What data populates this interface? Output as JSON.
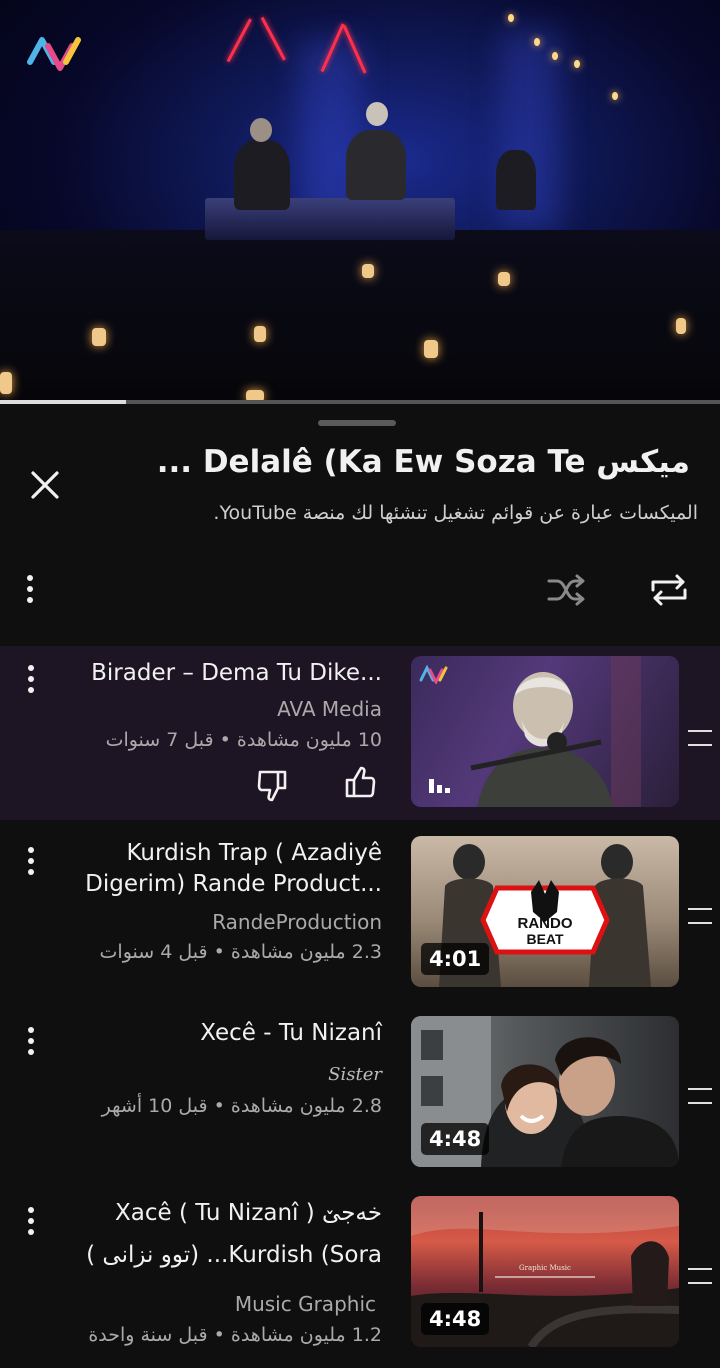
{
  "player": {
    "channel_logo": "ava-logo-icon",
    "progress_fraction": 0.175
  },
  "panel": {
    "title": "ميكس Delalê (Ka Ew Soza Te ...",
    "subtitle": "الميكسات عبارة عن قوائم تشغيل تنشئها لك منصة YouTube.",
    "icons": {
      "close": "close-icon",
      "more": "more-vert-icon",
      "shuffle": "shuffle-icon",
      "repeat": "repeat-icon"
    }
  },
  "items": [
    {
      "title": "Birader – Dema Tu Dike...",
      "channel": "AVA Media",
      "meta": "10 مليون مشاهدة • قبل 7 سنوات",
      "duration": "",
      "active": true
    },
    {
      "title": "Kurdish Trap ( Azadiyê Digerim) Rande Product...",
      "channel": "RandeProduction",
      "meta": "2.3 مليون مشاهدة • قبل 4 سنوات",
      "duration": "4:01",
      "thumb_text_1": "RANDO",
      "thumb_text_2": "BEAT"
    },
    {
      "title": "Xecê - Tu Nizanî",
      "channel": "Sister",
      "meta": "2.8 مليون مشاهدة • قبل 10 أشهر",
      "duration": "4:48"
    },
    {
      "title": "خەجێ ( Xacê ( Tu Nizanî",
      "title_line2": "Kurdish (Sora... (توو نزانی )",
      "channel": "Music Graphic",
      "meta": "1.2 مليون مشاهدة • قبل سنة واحدة",
      "duration": "4:48",
      "thumb_text_1": "Graphic Music"
    }
  ],
  "colors": {
    "background": "#0f0f0f",
    "active_row": "#1d1524",
    "secondary_text": "#aaaaaa"
  }
}
